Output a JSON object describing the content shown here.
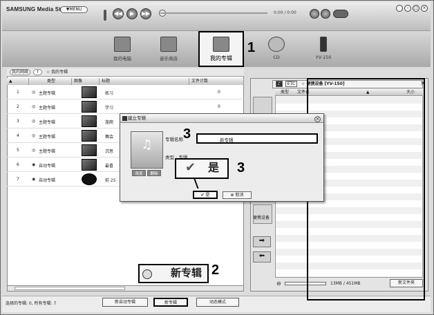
{
  "app": {
    "brand": "SAMSUNG Media Studio",
    "menu_label": "▼MENU",
    "time": "0:00 / 0:00"
  },
  "player": {
    "icons": [
      "rewind-icon",
      "play-icon",
      "forward-icon"
    ]
  },
  "nav": {
    "items": [
      {
        "label": "我的电脑"
      },
      {
        "label": "音乐商店"
      },
      {
        "label": "我的专辑"
      },
      {
        "label": "CD"
      },
      {
        "label": "YV-150"
      }
    ]
  },
  "callouts": {
    "c1": "1",
    "c2": "2",
    "c3a": "3",
    "c3b": "3"
  },
  "breadcrumb": {
    "back": "我的网络",
    "current": "☆ 我的专辑"
  },
  "table": {
    "headers": [
      "类型",
      "图像",
      "标题",
      "文件计数"
    ],
    "rows": [
      {
        "num": "1",
        "type": "主题专辑",
        "title": "练习",
        "count": "0"
      },
      {
        "num": "2",
        "type": "主题专辑",
        "title": "学习",
        "count": "0"
      },
      {
        "num": "3",
        "type": "主题专辑",
        "title": "笼爬",
        "count": ""
      },
      {
        "num": "4",
        "type": "主题专辑",
        "title": "舞会",
        "count": ""
      },
      {
        "num": "5",
        "type": "主题专辑",
        "title": "沉思",
        "count": ""
      },
      {
        "num": "6",
        "type": "自动专辑",
        "title": "最喜",
        "count": ""
      },
      {
        "num": "7",
        "type": "自动专辑",
        "title": "前 25",
        "count": ""
      }
    ]
  },
  "status": {
    "selection": "选择的专辑: 0, 所有专辑: 7",
    "new_auto_album": "新自动专辑",
    "new_album": "新专辑",
    "dynamic_mode": "动态模式"
  },
  "device": {
    "tab_label": "ETC",
    "title": "☆ 便携设备 [YV-150]",
    "col_type": "类型",
    "col_file": "文件名",
    "col_size": "大小",
    "side_label": "便携设备",
    "capacity": "13MB / 451MB",
    "new_folder": "新文件夹"
  },
  "dialog": {
    "title": "建立专辑",
    "name_label": "专辑名称",
    "name_value": "新专辑",
    "type_label": "类型 : 专辑",
    "change_btn": "改变",
    "delete_btn": "删除",
    "yes": "是",
    "cancel": "取消",
    "yes_big": "是"
  },
  "new_album_big": "新专辑"
}
